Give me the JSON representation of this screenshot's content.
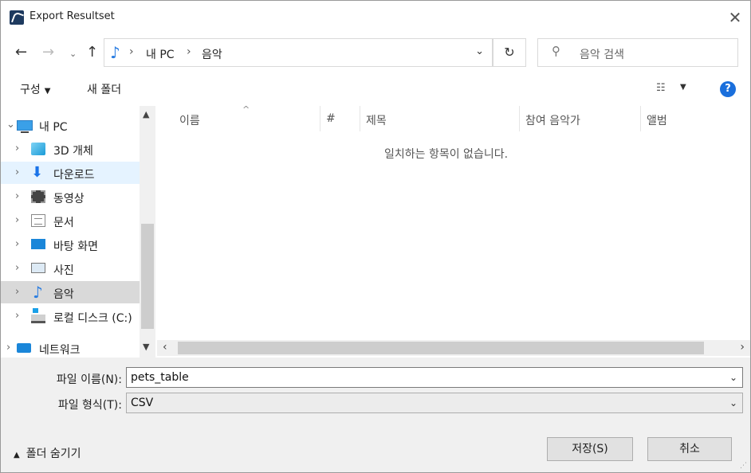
{
  "window": {
    "title": "Export Resultset"
  },
  "address": {
    "crumbs": [
      "내 PC",
      "음악"
    ]
  },
  "search": {
    "placeholder": "음악 검색"
  },
  "toolbar": {
    "organize": "구성",
    "new_folder": "새 폴더"
  },
  "nav_tree": [
    {
      "label": "내 PC",
      "icon": "computer-icon"
    },
    {
      "label": "3D 개체",
      "icon": "cube-icon"
    },
    {
      "label": "다운로드",
      "icon": "download-arrow-icon"
    },
    {
      "label": "동영상",
      "icon": "film-icon"
    },
    {
      "label": "문서",
      "icon": "document-icon"
    },
    {
      "label": "바탕 화면",
      "icon": "desktop-icon"
    },
    {
      "label": "사진",
      "icon": "picture-icon"
    },
    {
      "label": "음악",
      "icon": "music-note-icon"
    },
    {
      "label": "로컬 디스크 (C:)",
      "icon": "drive-icon"
    },
    {
      "label": "네트워크",
      "icon": "network-icon"
    }
  ],
  "columns": [
    "이름",
    "#",
    "제목",
    "참여 음악가",
    "앨범"
  ],
  "empty_message": "일치하는 항목이 없습니다.",
  "form": {
    "filename_label": "파일 이름(N):",
    "filename_value": "pets_table",
    "filetype_label": "파일 형식(T):",
    "filetype_value": "CSV"
  },
  "footer": {
    "hide_folders": "폴더 숨기기",
    "save": "저장(S)",
    "cancel": "취소"
  },
  "colors": {
    "accent": "#1a6fdc",
    "selection": "#e5f3ff",
    "selected_gray": "#d9d9d9"
  }
}
